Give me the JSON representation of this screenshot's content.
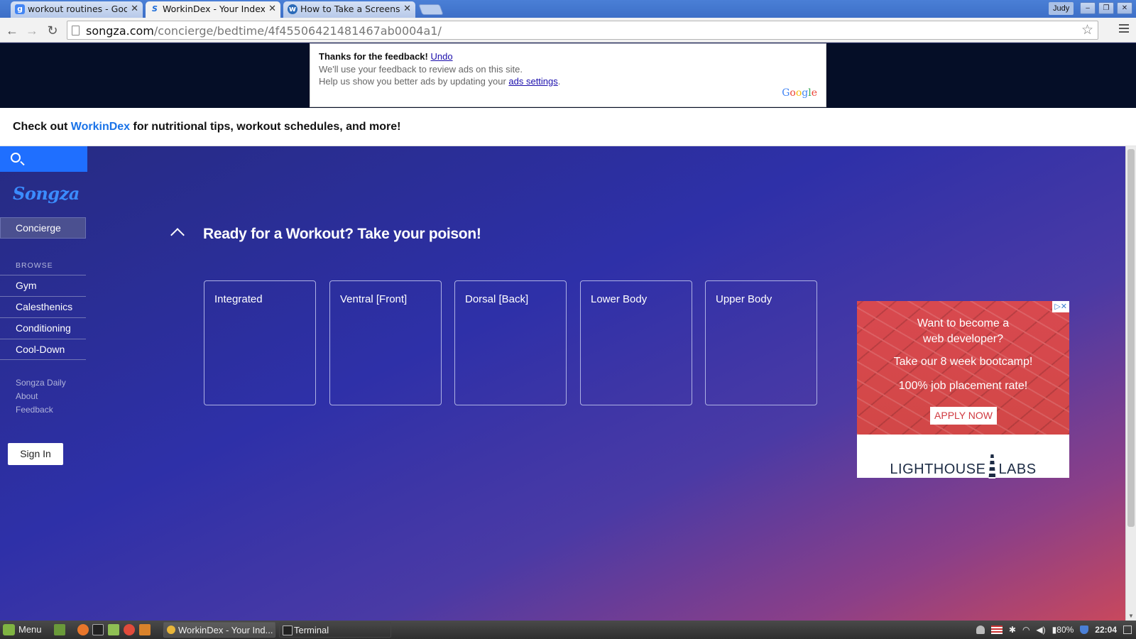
{
  "browser": {
    "tabs": [
      {
        "title": "workout routines - Googl",
        "favicon": "g",
        "active": false
      },
      {
        "title": "WorkinDex - Your Index",
        "favicon": "s",
        "active": true
      },
      {
        "title": "How to Take a Screensho",
        "favicon": "w",
        "active": false
      }
    ],
    "user": "Judy",
    "url_host": "songza.com",
    "url_path": "/concierge/bedtime/4f45506421481467ab0004a1/"
  },
  "ad_feedback": {
    "lead": "Thanks for the feedback!",
    "undo": "Undo",
    "line1": "We'll use your feedback to review ads on this site.",
    "line2_prefix": "Help us show you better ads by updating your ",
    "line2_link": "ads settings",
    "line2_suffix": ".",
    "google": [
      "G",
      "o",
      "o",
      "g",
      "l",
      "e"
    ]
  },
  "promo": {
    "prefix": "Check out ",
    "brand": "WorkinDex",
    "suffix": " for nutritional tips, workout schedules, and more!"
  },
  "sidebar": {
    "logo": "Songza",
    "active_item": "Concierge",
    "browse_heading": "BROWSE",
    "browse_items": [
      "Gym",
      "Calesthenics",
      "Conditioning",
      "Cool-Down"
    ],
    "footer_links": [
      "Songza Daily",
      "About",
      "Feedback"
    ],
    "signin": "Sign In"
  },
  "main": {
    "section_title": "Ready for a Workout? Take your poison!",
    "cards": [
      "Integrated",
      "Ventral [Front]",
      "Dorsal [Back]",
      "Lower Body",
      "Upper Body"
    ]
  },
  "ad": {
    "line1": "Want to become a",
    "line2": "web developer?",
    "line3": "Take our 8 week bootcamp!",
    "line4": "100% job placement rate!",
    "button": "APPLY NOW",
    "brand_left": "LIGHTHOUSE",
    "brand_right": "LABS",
    "choices": "▷✕"
  },
  "taskbar": {
    "menu": "Menu",
    "tasks": [
      "WorkinDex - Your Ind...",
      "Terminal"
    ],
    "battery": "80%",
    "time": "22:04"
  },
  "colors": {
    "accent": "#1f6fff",
    "brand_link": "#1a73e8",
    "ad_red": "#d8494f"
  }
}
